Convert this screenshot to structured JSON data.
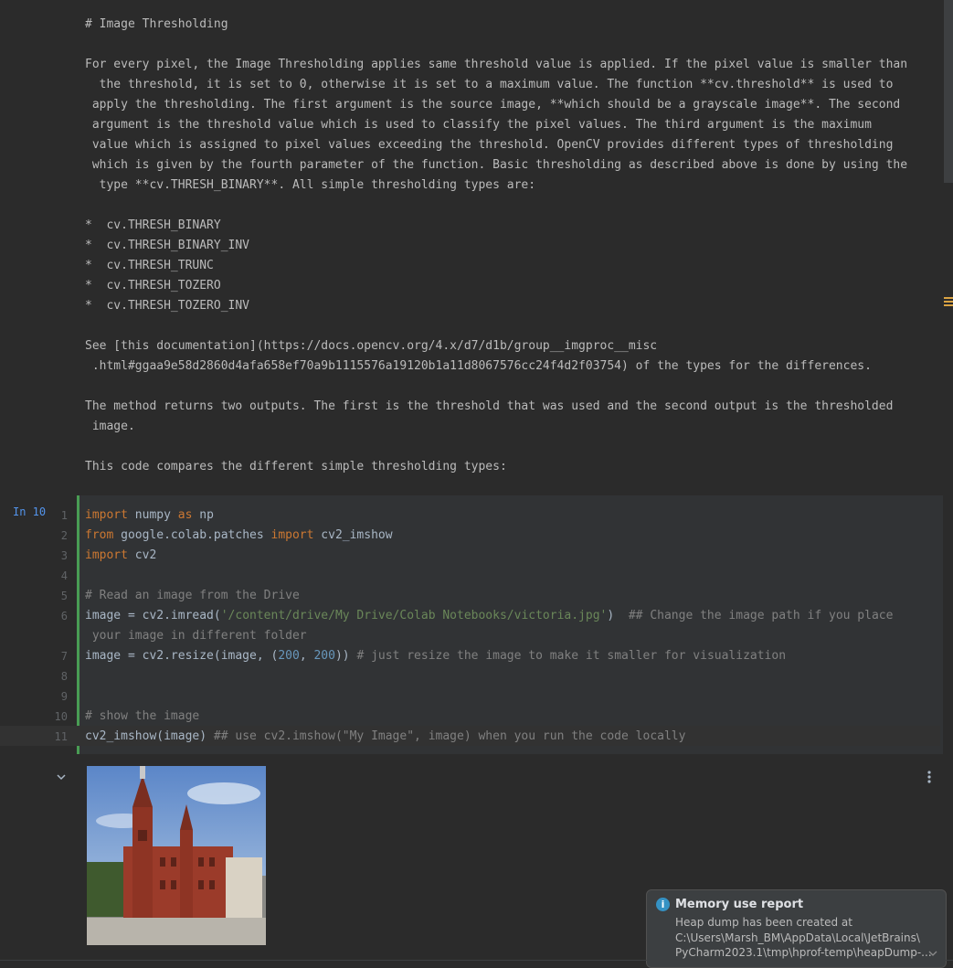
{
  "markdown_cell": {
    "lines": [
      "# Image Thresholding",
      "",
      "For every pixel, the Image Thresholding applies same threshold value is applied. If the pixel value is smaller than",
      "  the threshold, it is set to 0, otherwise it is set to a maximum value. The function **cv.threshold** is used to",
      " apply the thresholding. The first argument is the source image, **which should be a grayscale image**. The second",
      " argument is the threshold value which is used to classify the pixel values. The third argument is the maximum",
      " value which is assigned to pixel values exceeding the threshold. OpenCV provides different types of thresholding",
      " which is given by the fourth parameter of the function. Basic thresholding as described above is done by using the",
      "  type **cv.THRESH_BINARY**. All simple thresholding types are:",
      "",
      "*  cv.THRESH_BINARY",
      "*  cv.THRESH_BINARY_INV",
      "*  cv.THRESH_TRUNC",
      "*  cv.THRESH_TOZERO",
      "*  cv.THRESH_TOZERO_INV",
      "",
      "See [this documentation](https://docs.opencv.org/4.x/d7/d1b/group__imgproc__misc",
      " .html#ggaa9e58d2860d4afa658ef70a9b1115576a19120b1a11d8067576cc24f4d2f03754) of the types for the differences.",
      "",
      "The method returns two outputs. The first is the threshold that was used and the second output is the thresholded",
      " image.",
      "",
      "This code compares the different simple thresholding types:"
    ]
  },
  "code_cell": {
    "label": "In 10",
    "line_numbers": [
      "1",
      "2",
      "3",
      "4",
      "5",
      "6",
      "",
      "7",
      "8",
      "9",
      "10",
      "11"
    ],
    "rows": [
      [
        {
          "t": "import",
          "c": "kw"
        },
        {
          "t": " numpy ",
          "c": "pl"
        },
        {
          "t": "as",
          "c": "kw"
        },
        {
          "t": " np",
          "c": "pl"
        }
      ],
      [
        {
          "t": "from",
          "c": "kw"
        },
        {
          "t": " google.colab.patches ",
          "c": "pl"
        },
        {
          "t": "import",
          "c": "kw"
        },
        {
          "t": " cv2_imshow",
          "c": "pl"
        }
      ],
      [
        {
          "t": "import",
          "c": "kw"
        },
        {
          "t": " cv2",
          "c": "pl"
        }
      ],
      [],
      [
        {
          "t": "# Read an image from the Drive",
          "c": "cm"
        }
      ],
      [
        {
          "t": "image = cv2.imread(",
          "c": "pl"
        },
        {
          "t": "'/content/drive/My Drive/Colab Notebooks/victoria.jpg'",
          "c": "str"
        },
        {
          "t": ")  ",
          "c": "pl"
        },
        {
          "t": "## Change the image path if you place",
          "c": "cm"
        }
      ],
      [
        {
          "t": " your image in different folder",
          "c": "cm"
        }
      ],
      [
        {
          "t": "image = cv2.resize(image, (",
          "c": "pl"
        },
        {
          "t": "200",
          "c": "num"
        },
        {
          "t": ", ",
          "c": "pl"
        },
        {
          "t": "200",
          "c": "num"
        },
        {
          "t": ")) ",
          "c": "pl"
        },
        {
          "t": "# just resize the image to make it smaller for visualization",
          "c": "cm"
        }
      ],
      [],
      [],
      [
        {
          "t": "# show the image",
          "c": "cm"
        }
      ],
      [
        {
          "t": "cv2_imshow(image) ",
          "c": "pl"
        },
        {
          "t": "## use cv2.imshow(\"My Image\", image) when you run the code locally",
          "c": "cm"
        }
      ]
    ]
  },
  "output": {
    "image_alt": "victoria.jpg"
  },
  "notification": {
    "title": "Memory use report",
    "body": [
      "Heap dump has been created at",
      "C:\\Users\\Marsh_BM\\AppData\\Local\\JetBrains\\",
      "PyCharm2023.1\\tmp\\hprof-temp\\heapDump-..."
    ]
  },
  "colors": {
    "keyword": "#cc7832",
    "string": "#6a8759",
    "number": "#6897bb",
    "comment": "#808080",
    "cell_border": "#499c54"
  }
}
